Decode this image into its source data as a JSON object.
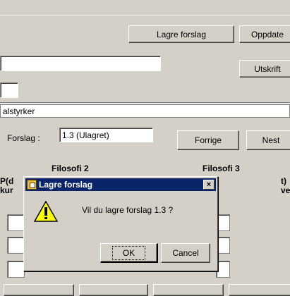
{
  "toolbar": {
    "save_proposal_button": "Lagre forslag",
    "update_button": "Oppdate",
    "print_button": "Utskrift"
  },
  "section": {
    "label": "alstyrker"
  },
  "proposal": {
    "label": "Forslag :",
    "value": "1.3 (Ulagret)",
    "prev_button": "Forrige",
    "next_button": "Nest"
  },
  "columns": {
    "philosophy2": "Filosofi 2",
    "philosophy3": "Filosofi 3",
    "left_header_line1": "P(d",
    "left_header_line2": "kur",
    "right_header_line1": "t)",
    "right_header_line2": "ve"
  },
  "dialog": {
    "title": "Lagre forslag",
    "message": "Vil du lagre forslag 1.3 ?",
    "ok": "OK",
    "cancel": "Cancel",
    "close_glyph": "×"
  }
}
